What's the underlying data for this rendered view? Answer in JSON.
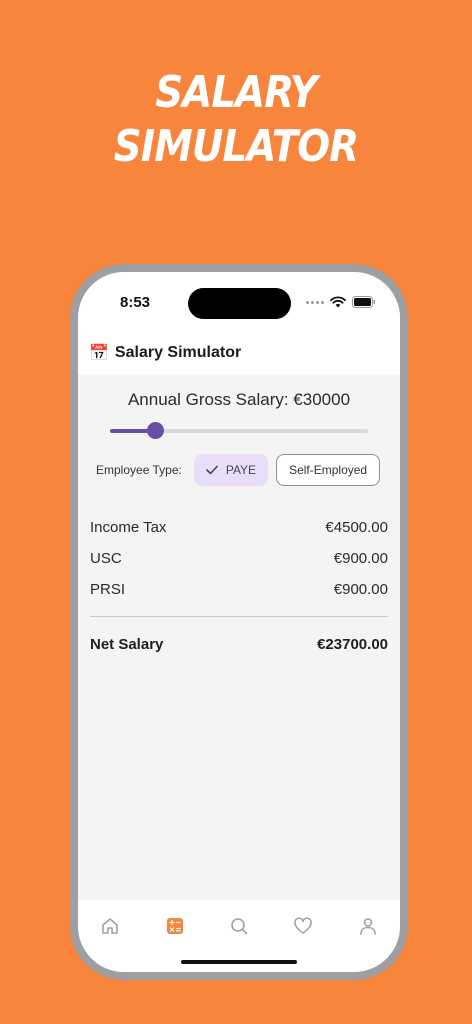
{
  "promo": {
    "line1": "SALARY",
    "line2": "SIMULATOR"
  },
  "status_bar": {
    "time": "8:53"
  },
  "header": {
    "icon": "calendar-icon",
    "emoji": "📅",
    "title": "Salary Simulator"
  },
  "simulator": {
    "gross_label": "Annual Gross Salary: €30000",
    "slider_fraction": 0.175,
    "employee_type_label": "Employee Type:",
    "options": [
      {
        "label": "PAYE",
        "selected": true
      },
      {
        "label": "Self-Employed",
        "selected": false
      }
    ]
  },
  "deductions": [
    {
      "label": "Income Tax",
      "value": "€4500.00"
    },
    {
      "label": "USC",
      "value": "€900.00"
    },
    {
      "label": "PRSI",
      "value": "€900.00"
    }
  ],
  "net": {
    "label": "Net Salary",
    "value": "€23700.00"
  },
  "tab_bar": {
    "tabs": [
      {
        "icon": "home-icon",
        "active": false
      },
      {
        "icon": "calculator-icon",
        "active": true
      },
      {
        "icon": "search-icon",
        "active": false
      },
      {
        "icon": "heart-icon",
        "active": false
      },
      {
        "icon": "profile-icon",
        "active": false
      }
    ]
  },
  "colors": {
    "background": "#F7853B",
    "accent": "#6750A4",
    "chip_selected": "#E8DEF8",
    "tab_active": "#F7853B",
    "tab_inactive": "#9AA3AF"
  }
}
